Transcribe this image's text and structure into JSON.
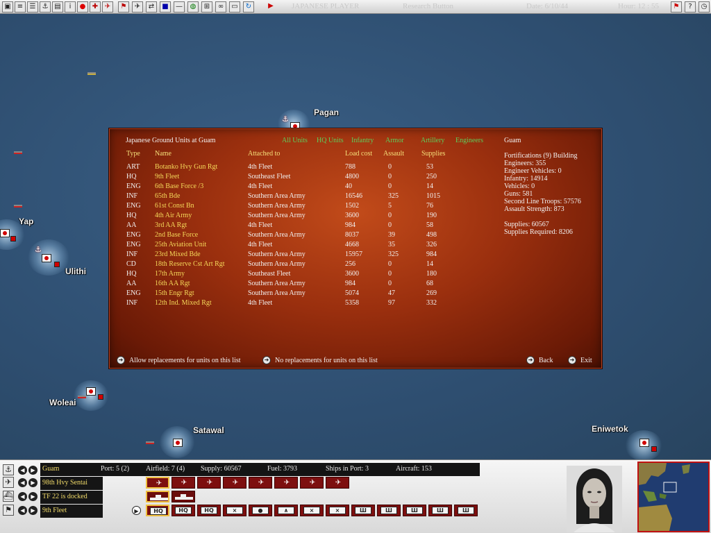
{
  "toolbar": {
    "title": "JAPANESE PLAYER",
    "research": "Research Button",
    "date": "Date: 6/10/44",
    "hour": "Hour: 12 : 55",
    "left_icons": [
      "save-icon",
      "report-icon",
      "list-icon",
      "ships-icon",
      "info-icon",
      "japan-flag-icon",
      "ground-icon",
      "air-icon",
      "flag-icon",
      "plane-icon",
      "intel-icon",
      "units-icon",
      "gray-icon",
      "globe-icon",
      "map-icon",
      "binoculars-icon",
      "bar-icon",
      "refresh-icon",
      "play-icon"
    ],
    "right_icons": [
      "mark-icon",
      "help-icon",
      "clock-icon"
    ]
  },
  "map": {
    "locations": [
      "Pagan",
      "Yap",
      "Ulithi",
      "Woleai",
      "Satawal",
      "Eniwetok"
    ]
  },
  "dialog": {
    "title": "Japanese Ground Units at Guam",
    "filters": [
      "All Units",
      "HQ Units",
      "Infantry",
      "Armor",
      "Artillery",
      "Engineers"
    ],
    "columns": {
      "type": "Type",
      "name": "Name",
      "attached": "Attached to",
      "load": "Load cost",
      "assault": "Assault",
      "supplies": "Supplies"
    },
    "rows": [
      {
        "type": "ART",
        "name": "Botanko Hvy Gun Rgt",
        "attached": "4th Fleet",
        "load": "788",
        "assault": "0",
        "supplies": "53"
      },
      {
        "type": "HQ",
        "name": "9th Fleet",
        "attached": "Southeast Fleet",
        "load": "4800",
        "assault": "0",
        "supplies": "250"
      },
      {
        "type": "ENG",
        "name": "6th Base Force /3",
        "attached": "4th Fleet",
        "load": "40",
        "assault": "0",
        "supplies": "14"
      },
      {
        "type": "INF",
        "name": "65th Bde",
        "attached": "Southern Area Army",
        "load": "16546",
        "assault": "325",
        "supplies": "1015"
      },
      {
        "type": "ENG",
        "name": "61st Const Bn",
        "attached": "Southern Area Army",
        "load": "1502",
        "assault": "5",
        "supplies": "76"
      },
      {
        "type": "HQ",
        "name": "4th Air Army",
        "attached": "Southern Area Army",
        "load": "3600",
        "assault": "0",
        "supplies": "190"
      },
      {
        "type": "AA",
        "name": "3rd AA Rgt",
        "attached": "4th Fleet",
        "load": "984",
        "assault": "0",
        "supplies": "58"
      },
      {
        "type": "ENG",
        "name": "2nd Base Force",
        "attached": "Southern Area Army",
        "load": "8037",
        "assault": "39",
        "supplies": "498"
      },
      {
        "type": "ENG",
        "name": "25th Aviation Unit",
        "attached": "4th Fleet",
        "load": "4668",
        "assault": "35",
        "supplies": "326"
      },
      {
        "type": "INF",
        "name": "23rd Mixed Bde",
        "attached": "Southern Area Army",
        "load": "15957",
        "assault": "325",
        "supplies": "984"
      },
      {
        "type": "CD",
        "name": "18th Reserve Cst Art Rgt",
        "attached": "Southern Area Army",
        "load": "256",
        "assault": "0",
        "supplies": "14"
      },
      {
        "type": "HQ",
        "name": "17th Army",
        "attached": "Southeast Fleet",
        "load": "3600",
        "assault": "0",
        "supplies": "180"
      },
      {
        "type": "AA",
        "name": "16th AA Rgt",
        "attached": "Southern Area Army",
        "load": "984",
        "assault": "0",
        "supplies": "68"
      },
      {
        "type": "ENG",
        "name": "15th Engr Rgt",
        "attached": "Southern Area Army",
        "load": "5074",
        "assault": "47",
        "supplies": "269"
      },
      {
        "type": "INF",
        "name": "12th Ind. Mixed Rgt",
        "attached": "4th Fleet",
        "load": "5358",
        "assault": "97",
        "supplies": "332"
      }
    ],
    "summary": {
      "location": "Guam",
      "fortifications": "Fortifications (9) Building",
      "engineers": "Engineers: 355",
      "engineer_vehicles": "Engineer Vehicles: 0",
      "infantry": "Infantry: 14914",
      "vehicles": "Vehicles: 0",
      "guns": "Guns: 581",
      "second_line": "Second Line Troops: 57576",
      "assault_strength": "Assault Strength: 873",
      "supplies": "Supplies: 60567",
      "supplies_required": "Supplies Required: 8206"
    },
    "footer": {
      "allow": "Allow replacements for units on this list",
      "no_replace": "No replacements for units on this list",
      "back": "Back",
      "exit": "Exit"
    }
  },
  "bottom": {
    "location": "Guam",
    "port": "Port: 5 (2)",
    "airfield": "Airfield: 7 (4)",
    "supply": "Supply: 60567",
    "fuel": "Fuel: 3793",
    "ships": "Ships in Port: 3",
    "aircraft": "Aircraft: 153",
    "air_unit": "98th Hvy Sentai",
    "task_force": "TF 22 is docked",
    "ground_unit": "9th Fleet",
    "ground_slots": [
      "HQ",
      "HQ",
      "HQ",
      "INF",
      "ART",
      "AA",
      "INF",
      "INF",
      "ENG",
      "CD",
      "CD",
      "CD",
      "CD"
    ]
  }
}
